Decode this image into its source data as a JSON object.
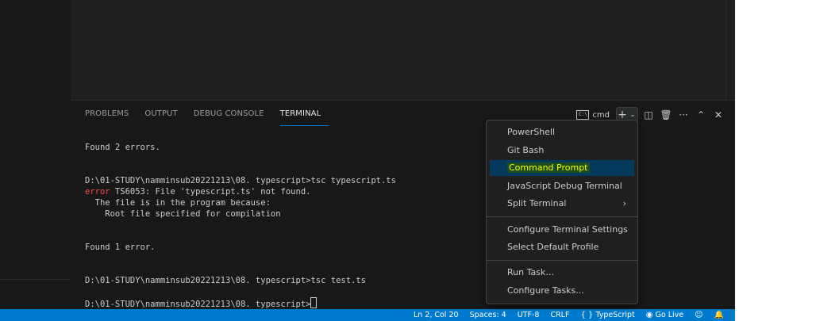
{
  "panel": {
    "tabs": [
      {
        "label": "PROBLEMS"
      },
      {
        "label": "OUTPUT"
      },
      {
        "label": "DEBUG CONSOLE"
      },
      {
        "label": "TERMINAL"
      }
    ],
    "active_tab": "TERMINAL",
    "terminal_name": "cmd",
    "terminal_icon_glyph": "C:\\",
    "actions": {
      "new_terminal_glyph": "+",
      "dropdown_glyph": "⌄",
      "split_glyph": "◫",
      "trash_glyph": "🗑",
      "more_glyph": "···",
      "maximize_glyph": "⌃",
      "close_glyph": "✕"
    }
  },
  "terminal": {
    "lines": [
      {
        "text": "Found 2 errors.",
        "type": "normal"
      },
      {
        "text": "",
        "type": "normal"
      },
      {
        "text": "",
        "type": "normal"
      },
      {
        "text": "D:\\01-STUDY\\namminsub20221213\\08. typescript>tsc typescript.ts",
        "type": "normal"
      },
      {
        "text": "error",
        "type": "error",
        "rest": " TS6053: File 'typescript.ts' not found."
      },
      {
        "text": "  The file is in the program because:",
        "type": "normal"
      },
      {
        "text": "    Root file specified for compilation",
        "type": "normal"
      },
      {
        "text": "",
        "type": "normal"
      },
      {
        "text": "",
        "type": "normal"
      },
      {
        "text": "Found 1 error.",
        "type": "normal"
      },
      {
        "text": "",
        "type": "normal"
      },
      {
        "text": "",
        "type": "normal"
      },
      {
        "text": "D:\\01-STUDY\\namminsub20221213\\08. typescript>tsc test.ts",
        "type": "normal"
      },
      {
        "text": "",
        "type": "normal"
      },
      {
        "text": "D:\\01-STUDY\\namminsub20221213\\08. typescript>",
        "type": "prompt"
      }
    ]
  },
  "menu": {
    "items": [
      {
        "label": "PowerShell"
      },
      {
        "label": "Git Bash"
      },
      {
        "label": "Command Prompt",
        "selected": true
      },
      {
        "label": "JavaScript Debug Terminal"
      },
      {
        "label": "Split Terminal",
        "submenu": true
      },
      {
        "label": "Configure Terminal Settings"
      },
      {
        "label": "Select Default Profile"
      },
      {
        "label": "Run Task..."
      },
      {
        "label": "Configure Tasks..."
      }
    ],
    "submenu_arrow": "›"
  },
  "status_bar": {
    "position": "Ln 2, Col 20",
    "spaces": "Spaces: 4",
    "encoding": "UTF-8",
    "eol": "CRLF",
    "language_glyph": "{ }",
    "language": "TypeScript",
    "golive_glyph": "◉",
    "golive": "Go Live",
    "feedback_glyph": "☺",
    "bell_glyph": "🔔"
  },
  "colors": {
    "accent": "#0078d4",
    "status_bar": "#007acc",
    "error": "#f14c4c",
    "selected_item": "#04395e",
    "highlight_text": "#ffff00"
  }
}
